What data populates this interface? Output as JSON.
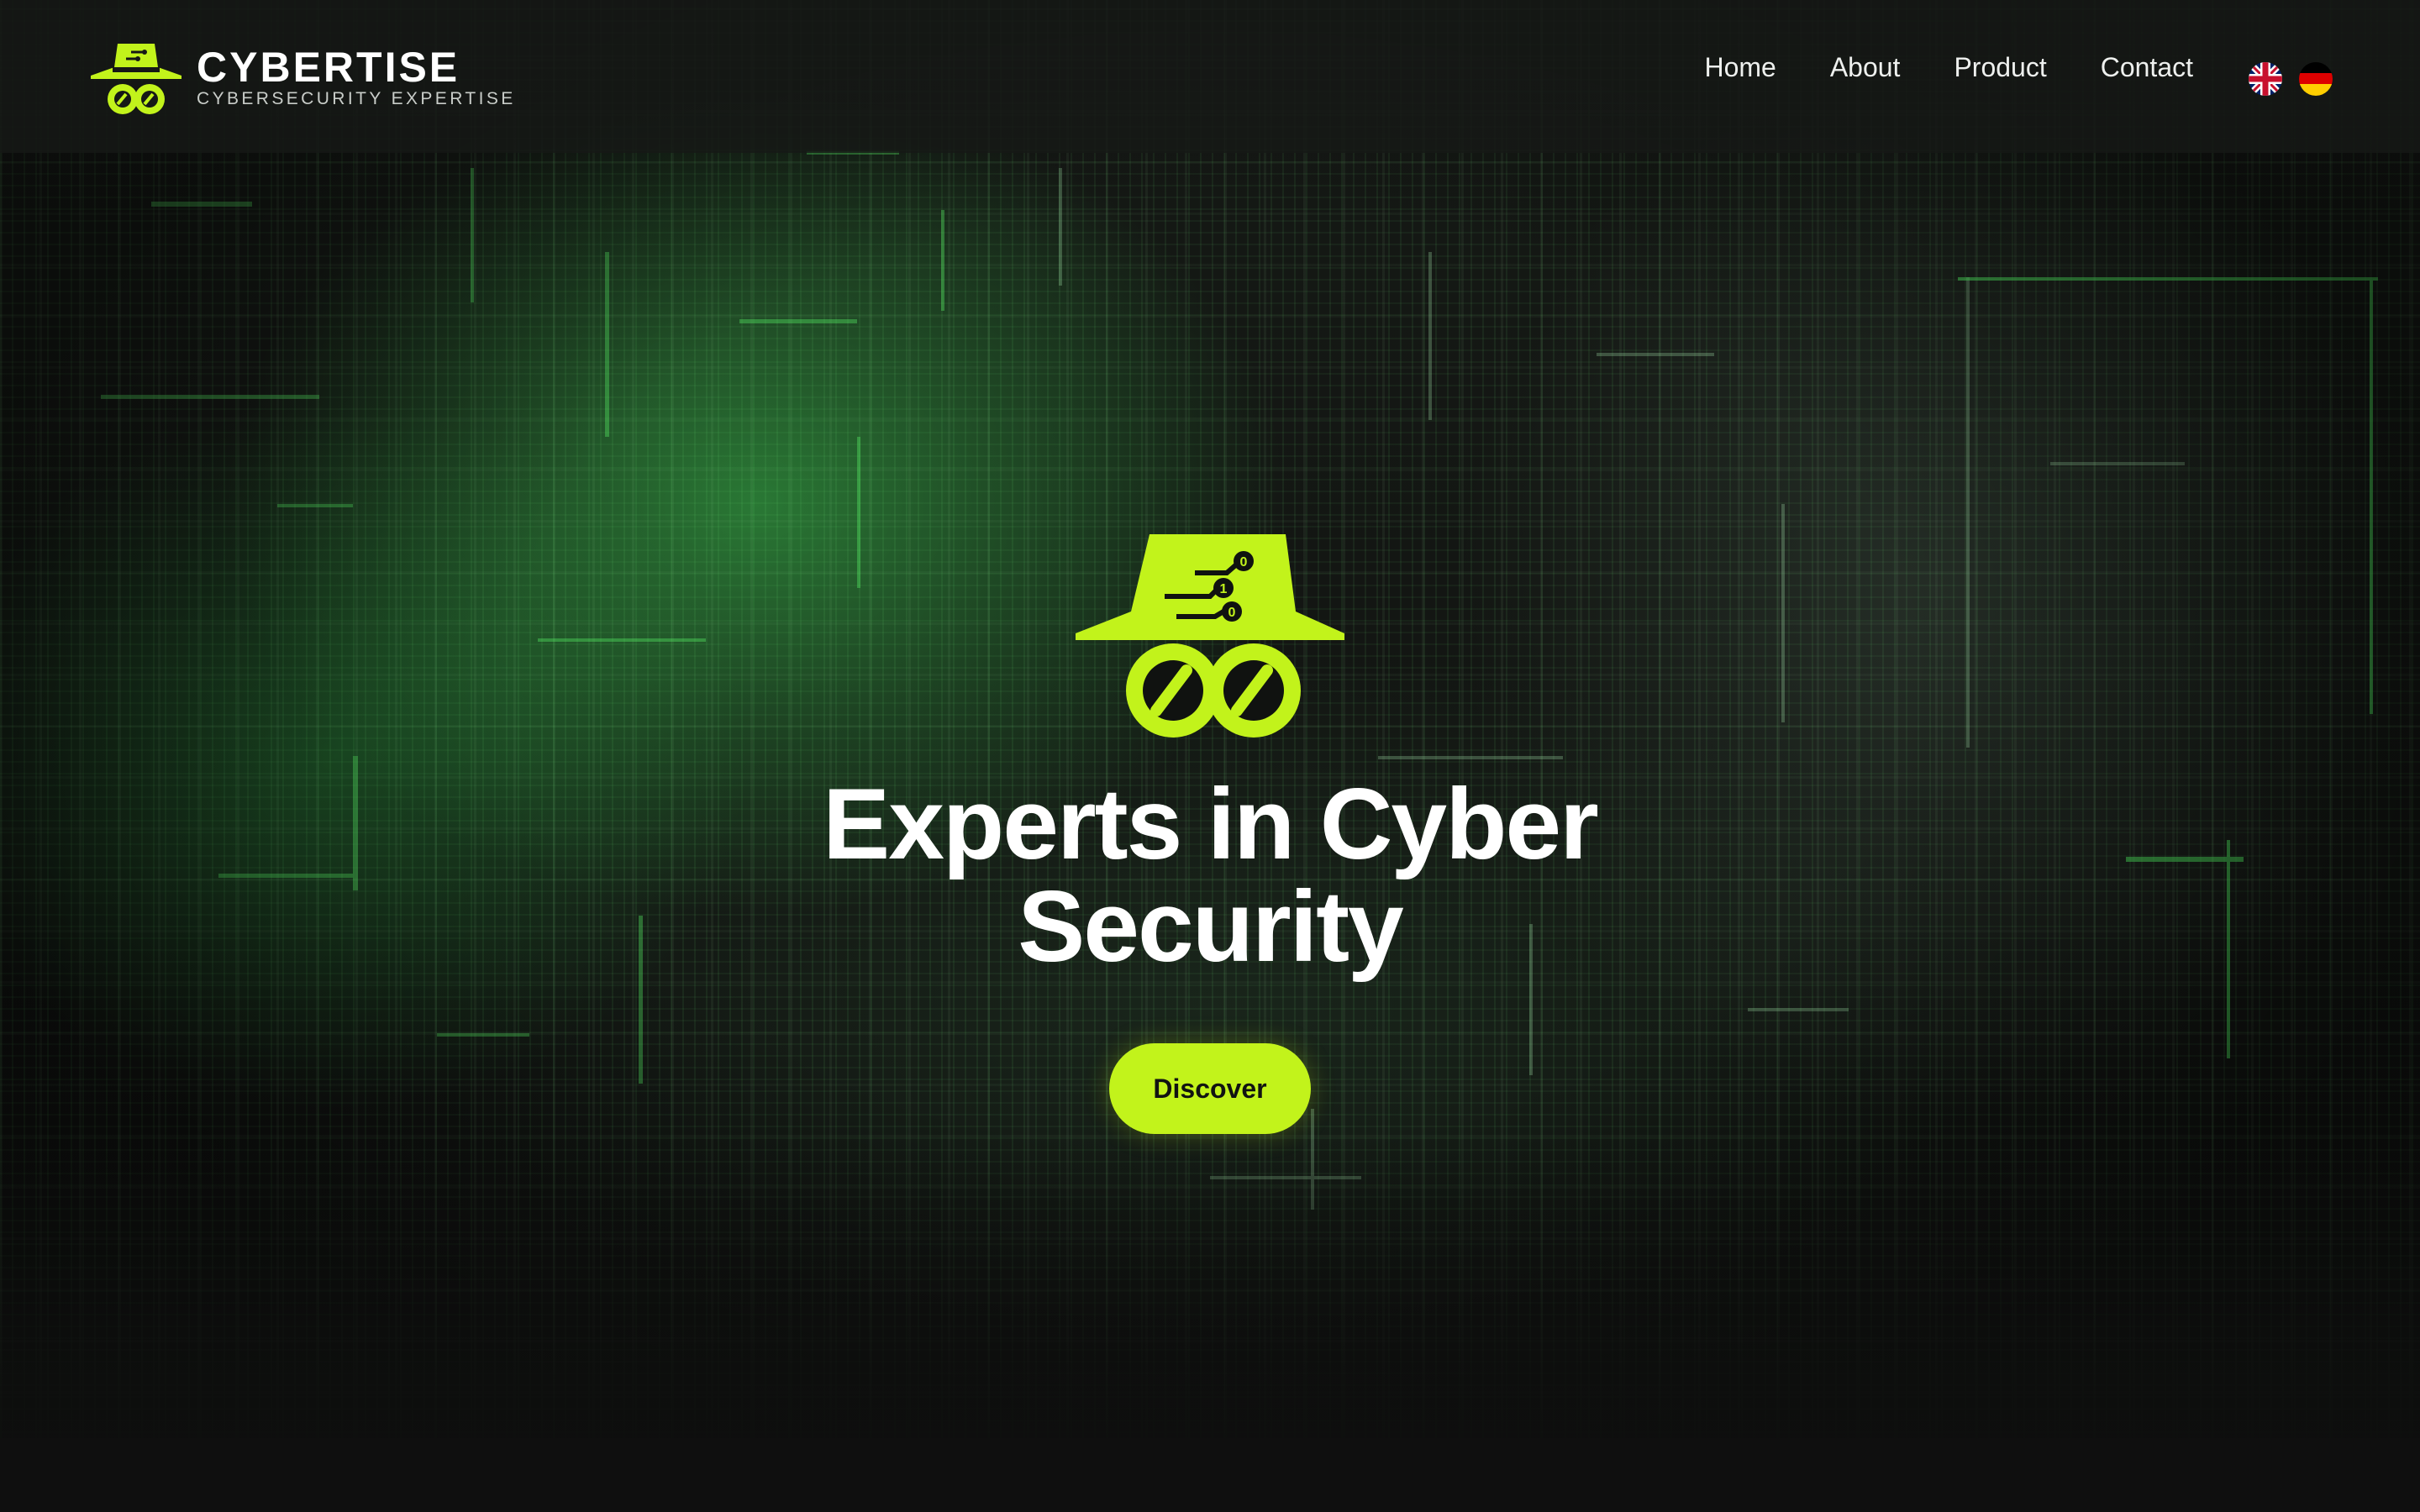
{
  "brand": {
    "name": "CYBERTISE",
    "tagline": "CYBERSECURITY EXPERTISE",
    "logo_icon": "spy-hat-glasses-icon"
  },
  "nav": {
    "items": [
      {
        "label": "Home"
      },
      {
        "label": "About"
      },
      {
        "label": "Product"
      },
      {
        "label": "Contact"
      }
    ]
  },
  "languages": [
    {
      "icon": "uk-flag-icon"
    },
    {
      "icon": "german-flag-icon"
    }
  ],
  "hero": {
    "logo_icon": "spy-hat-glasses-icon",
    "logo_digits": [
      "0",
      "1",
      "0"
    ],
    "title_line1": "Experts in Cyber",
    "title_line2": "Security",
    "cta_label": "Discover"
  },
  "colors": {
    "accent": "#c2f31b",
    "header_bg": "#161816",
    "background": "#0f100f",
    "text": "#ffffff"
  }
}
